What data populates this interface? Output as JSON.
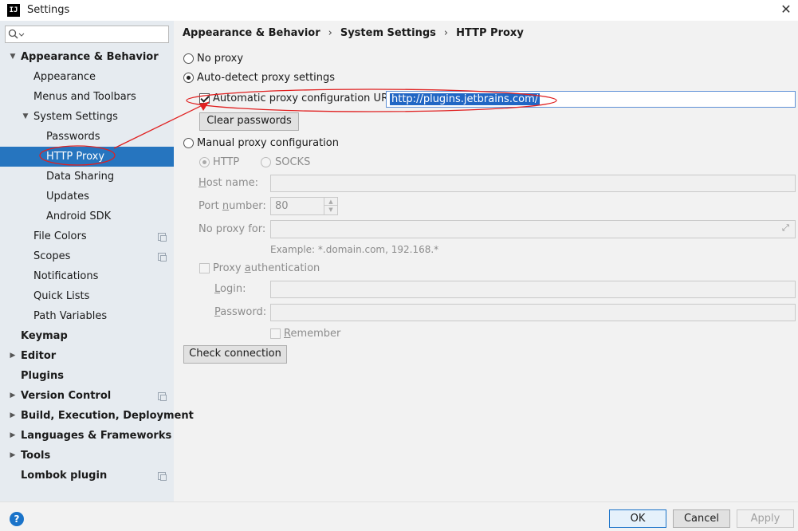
{
  "window": {
    "title": "Settings",
    "app_icon": "IJ"
  },
  "search": {
    "placeholder": ""
  },
  "sidebar": {
    "items": [
      {
        "label": "Appearance & Behavior",
        "level": 0,
        "bold": true,
        "arrow": "expanded"
      },
      {
        "label": "Appearance",
        "level": 1
      },
      {
        "label": "Menus and Toolbars",
        "level": 1
      },
      {
        "label": "System Settings",
        "level": 1,
        "arrow": "expanded"
      },
      {
        "label": "Passwords",
        "level": 2
      },
      {
        "label": "HTTP Proxy",
        "level": 2,
        "selected": true
      },
      {
        "label": "Data Sharing",
        "level": 2
      },
      {
        "label": "Updates",
        "level": 2
      },
      {
        "label": "Android SDK",
        "level": 2
      },
      {
        "label": "File Colors",
        "level": 1,
        "copy_icon": true
      },
      {
        "label": "Scopes",
        "level": 1,
        "copy_icon": true
      },
      {
        "label": "Notifications",
        "level": 1
      },
      {
        "label": "Quick Lists",
        "level": 1
      },
      {
        "label": "Path Variables",
        "level": 1
      },
      {
        "label": "Keymap",
        "level": 0,
        "bold": true
      },
      {
        "label": "Editor",
        "level": 0,
        "bold": true,
        "arrow": "collapsed"
      },
      {
        "label": "Plugins",
        "level": 0,
        "bold": true
      },
      {
        "label": "Version Control",
        "level": 0,
        "bold": true,
        "arrow": "collapsed",
        "copy_icon": true
      },
      {
        "label": "Build, Execution, Deployment",
        "level": 0,
        "bold": true,
        "arrow": "collapsed"
      },
      {
        "label": "Languages & Frameworks",
        "level": 0,
        "bold": true,
        "arrow": "collapsed"
      },
      {
        "label": "Tools",
        "level": 0,
        "bold": true,
        "arrow": "collapsed"
      },
      {
        "label": "Lombok plugin",
        "level": 0,
        "bold": true,
        "copy_icon": true
      }
    ]
  },
  "breadcrumb": {
    "items": [
      "Appearance & Behavior",
      "System Settings",
      "HTTP Proxy"
    ],
    "separator": "›"
  },
  "proxy": {
    "no_proxy_label": "No proxy",
    "auto_detect_label": "Auto-detect proxy settings",
    "auto_config_url_label": "Automatic proxy configuration URL:",
    "auto_config_url_value": "http://plugins.jetbrains.com/",
    "clear_passwords_label": "Clear passwords",
    "manual_label": "Manual proxy configuration",
    "http_label": "HTTP",
    "socks_label": "SOCKS",
    "host_name_label_pre": "",
    "host_name_label_u": "H",
    "host_name_label_post": "ost name:",
    "port_number_label_pre": "Port ",
    "port_number_label_u": "n",
    "port_number_label_post": "umber:",
    "port_value": "80",
    "no_proxy_for_label": "No proxy for:",
    "example_text": "Example: *.domain.com, 192.168.*",
    "proxy_auth_pre": "Proxy ",
    "proxy_auth_u": "a",
    "proxy_auth_post": "uthentication",
    "login_label_u": "L",
    "login_label_post": "ogin:",
    "password_label_u": "P",
    "password_label_post": "assword:",
    "remember_u": "R",
    "remember_post": "emember",
    "check_connection_label": "Check connection",
    "selected_mode": "auto_detect",
    "auto_config_checked": true
  },
  "footer": {
    "help_label": "?",
    "ok_label": "OK",
    "cancel_label": "Cancel",
    "apply_label": "Apply"
  },
  "colors": {
    "selection": "#2675bf",
    "annotation": "#e02020",
    "sidebar_bg": "#e6ebf0"
  }
}
